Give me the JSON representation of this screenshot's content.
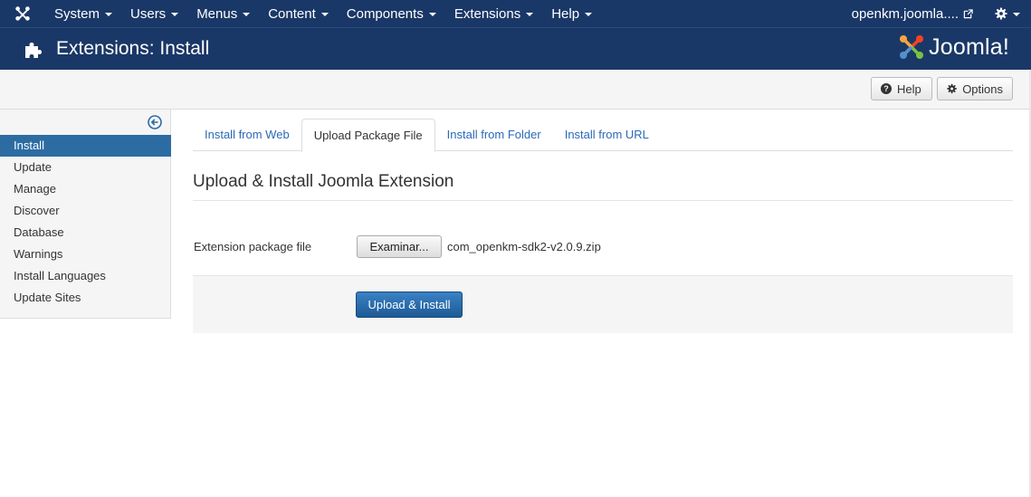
{
  "navbar": {
    "menu": [
      {
        "label": "System"
      },
      {
        "label": "Users"
      },
      {
        "label": "Menus"
      },
      {
        "label": "Content"
      },
      {
        "label": "Components"
      },
      {
        "label": "Extensions"
      },
      {
        "label": "Help"
      }
    ],
    "site_link": "openkm.joomla....",
    "icons": {
      "logo": "joomla-icon",
      "external": "external-link-icon",
      "settings": "gear-icon"
    }
  },
  "header": {
    "title": "Extensions: Install",
    "icon": "puzzle-icon",
    "brand": "Joomla!"
  },
  "toolbar": {
    "help_label": "Help",
    "options_label": "Options"
  },
  "sidebar": {
    "items": [
      {
        "label": "Install",
        "active": true
      },
      {
        "label": "Update"
      },
      {
        "label": "Manage"
      },
      {
        "label": "Discover"
      },
      {
        "label": "Database"
      },
      {
        "label": "Warnings"
      },
      {
        "label": "Install Languages"
      },
      {
        "label": "Update Sites"
      }
    ]
  },
  "tabs": [
    {
      "label": "Install from Web"
    },
    {
      "label": "Upload Package File",
      "active": true
    },
    {
      "label": "Install from Folder"
    },
    {
      "label": "Install from URL"
    }
  ],
  "main": {
    "section_title": "Upload & Install Joomla Extension",
    "field_label": "Extension package file",
    "browse_label": "Examinar...",
    "file_name": "com_openkm-sdk2-v2.0.9.zip",
    "submit_label": "Upload & Install"
  },
  "colors": {
    "navbar_bg": "#1a3867",
    "active_blue": "#2d6ca2",
    "link_blue": "#2a69b8",
    "primary_button": "#2a6fb0"
  }
}
